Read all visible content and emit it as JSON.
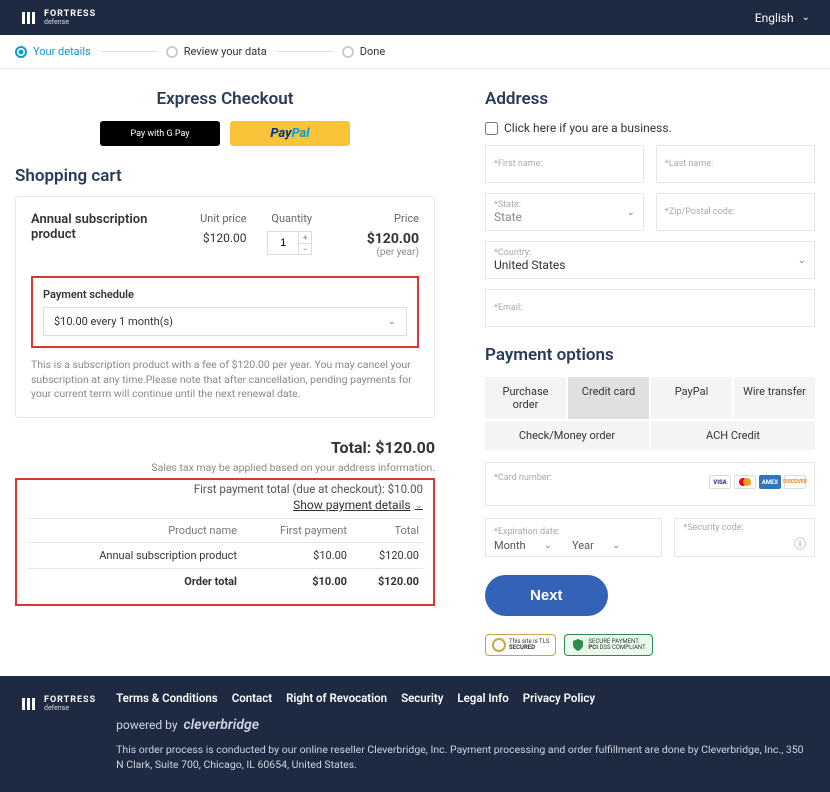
{
  "header": {
    "brand1": "FORTRESS",
    "brand2": "defense",
    "language": "English"
  },
  "steps": {
    "s1": "Your details",
    "s2": "Review your data",
    "s3": "Done"
  },
  "express": {
    "title": "Express Checkout",
    "gpay": "Pay with G Pay",
    "pp1": "Pay",
    "pp2": "Pal"
  },
  "cart": {
    "heading": "Shopping cart",
    "item_name": "Annual subscription product",
    "unit_label": "Unit price",
    "unit_value": "$120.00",
    "qty_label": "Quantity",
    "qty_value": "1",
    "price_label": "Price",
    "price_value": "$120.00",
    "per_year": "(per year)",
    "schedule_label": "Payment schedule",
    "schedule_value": "$10.00 every 1 month(s)",
    "note": "This is a subscription product with a fee of $120.00 per year. You may cancel your subscription at any time.Please note that after cancellation, pending payments for your current term will continue until the next renewal date."
  },
  "totals": {
    "total_label": "Total: $120.00",
    "tax_note": "Sales tax may be applied based on your address information.",
    "first_payment": "First payment total (due at checkout):   $10.00",
    "show": "Show payment details",
    "th_name": "Product name",
    "th_first": "First payment",
    "th_total": "Total",
    "row_name": "Annual subscription product",
    "row_first": "$10.00",
    "row_total": "$120.00",
    "ot_label": "Order total",
    "ot_first": "$10.00",
    "ot_total": "$120.00"
  },
  "address": {
    "heading": "Address",
    "biz": "Click here if you are a business.",
    "first": "First name:",
    "last": "Last name:",
    "state_lbl": "State:",
    "state_val": "State",
    "zip": "Zip/Postal code:",
    "country_lbl": "Country:",
    "country_val": "United States",
    "email": "Email:"
  },
  "payment": {
    "heading": "Payment options",
    "po": "Purchase order",
    "cc": "Credit card",
    "pp": "PayPal",
    "wt": "Wire transfer",
    "cmo": "Check/Money order",
    "ach": "ACH Credit",
    "cardnum": "Card number:",
    "exp": "Expiration date:",
    "month": "Month",
    "year": "Year",
    "sec": "Security code:",
    "next": "Next"
  },
  "footer": {
    "links": [
      "Terms & Conditions",
      "Contact",
      "Right of Revocation",
      "Security",
      "Legal Info",
      "Privacy Policy"
    ],
    "powered": "powered by",
    "cb": "cleverbridge",
    "disclaimer": "This order process is conducted by our online reseller Cleverbridge, Inc. Payment processing and order fulfillment are done by Cleverbridge, Inc., 350 N Clark, Suite 700, Chicago, IL 60654, United States."
  }
}
